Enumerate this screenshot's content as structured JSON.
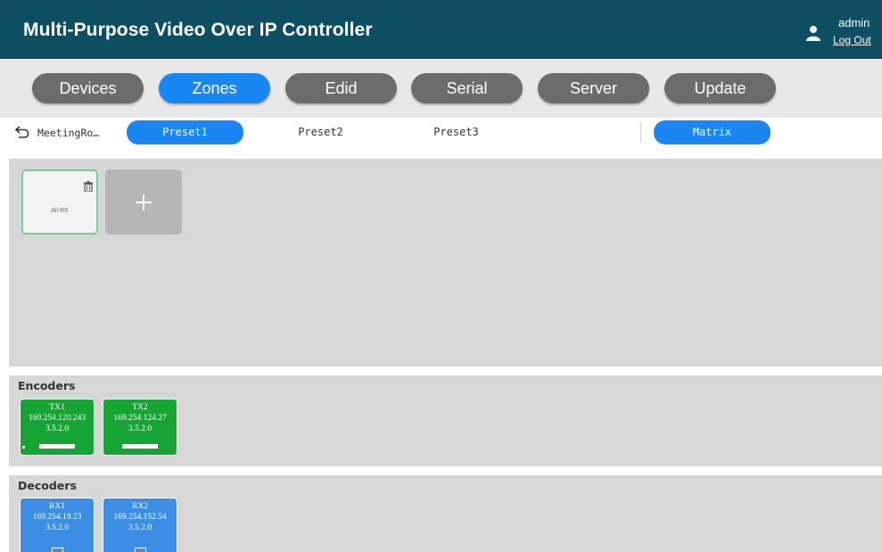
{
  "header": {
    "title": "Multi-Purpose Video Over IP Controller",
    "user": "admin",
    "logout_label": "Log Out",
    "user_icon": "user-icon",
    "color": "#0d4e62"
  },
  "nav": {
    "active": "Zones",
    "items": [
      {
        "label": "Devices"
      },
      {
        "label": "Zones"
      },
      {
        "label": "Edid"
      },
      {
        "label": "Serial"
      },
      {
        "label": "Server"
      },
      {
        "label": "Update"
      }
    ],
    "active_color": "#1a86f2",
    "inactive_color": "#6c6c6c"
  },
  "subnav": {
    "back_icon": "back-arrow-icon",
    "zone_name": "MeetingRo…",
    "presets": [
      {
        "label": "Preset1",
        "active": true
      },
      {
        "label": "Preset2",
        "active": false
      },
      {
        "label": "Preset3",
        "active": false
      }
    ],
    "matrix_label": "Matrix"
  },
  "zone_panel": {
    "groups": [
      {
        "label": "All RX",
        "icon": "trash-icon"
      }
    ],
    "add_icon": "plus-icon"
  },
  "encoders": {
    "title": "Encoders",
    "color": "#16a534",
    "devices": [
      {
        "name": "TX1",
        "ip": "169.254.120.243",
        "version": "3.5.2.0"
      },
      {
        "name": "TX2",
        "ip": "169.254.124.27",
        "version": "3.5.2.0"
      }
    ]
  },
  "decoders": {
    "title": "Decoders",
    "color": "#3b8ee3",
    "devices": [
      {
        "name": "RX1",
        "ip": "169.254.19.23",
        "version": "3.5.2.0"
      },
      {
        "name": "RX2",
        "ip": "169.254.152.54",
        "version": "3.5.2.0"
      }
    ]
  }
}
